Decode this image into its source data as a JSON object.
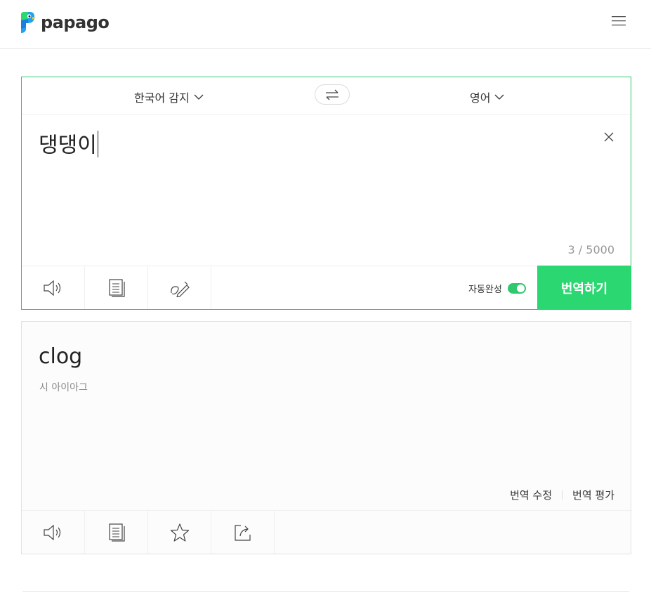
{
  "header": {
    "logo_text": "papago",
    "logo_icon": "papago-parrot-logo",
    "menu_icon": "hamburger-menu-icon"
  },
  "source": {
    "language": "한국어 감지",
    "text": "댕댕이",
    "char_count": "3 / 5000",
    "autocomplete_label": "자동완성",
    "autocomplete_on": true,
    "translate_label": "번역하기",
    "tools": [
      "speaker-icon",
      "copy-icon",
      "handwriting-icon"
    ]
  },
  "target": {
    "language": "영어",
    "text": "clog",
    "pronunciation": "시 아이아그",
    "edit_label": "번역 수정",
    "rate_label": "번역 평가",
    "tools": [
      "speaker-icon",
      "copy-icon",
      "star-icon",
      "share-icon"
    ]
  },
  "colors": {
    "accent": "#2bd770",
    "border_active": "#2fc86f"
  }
}
